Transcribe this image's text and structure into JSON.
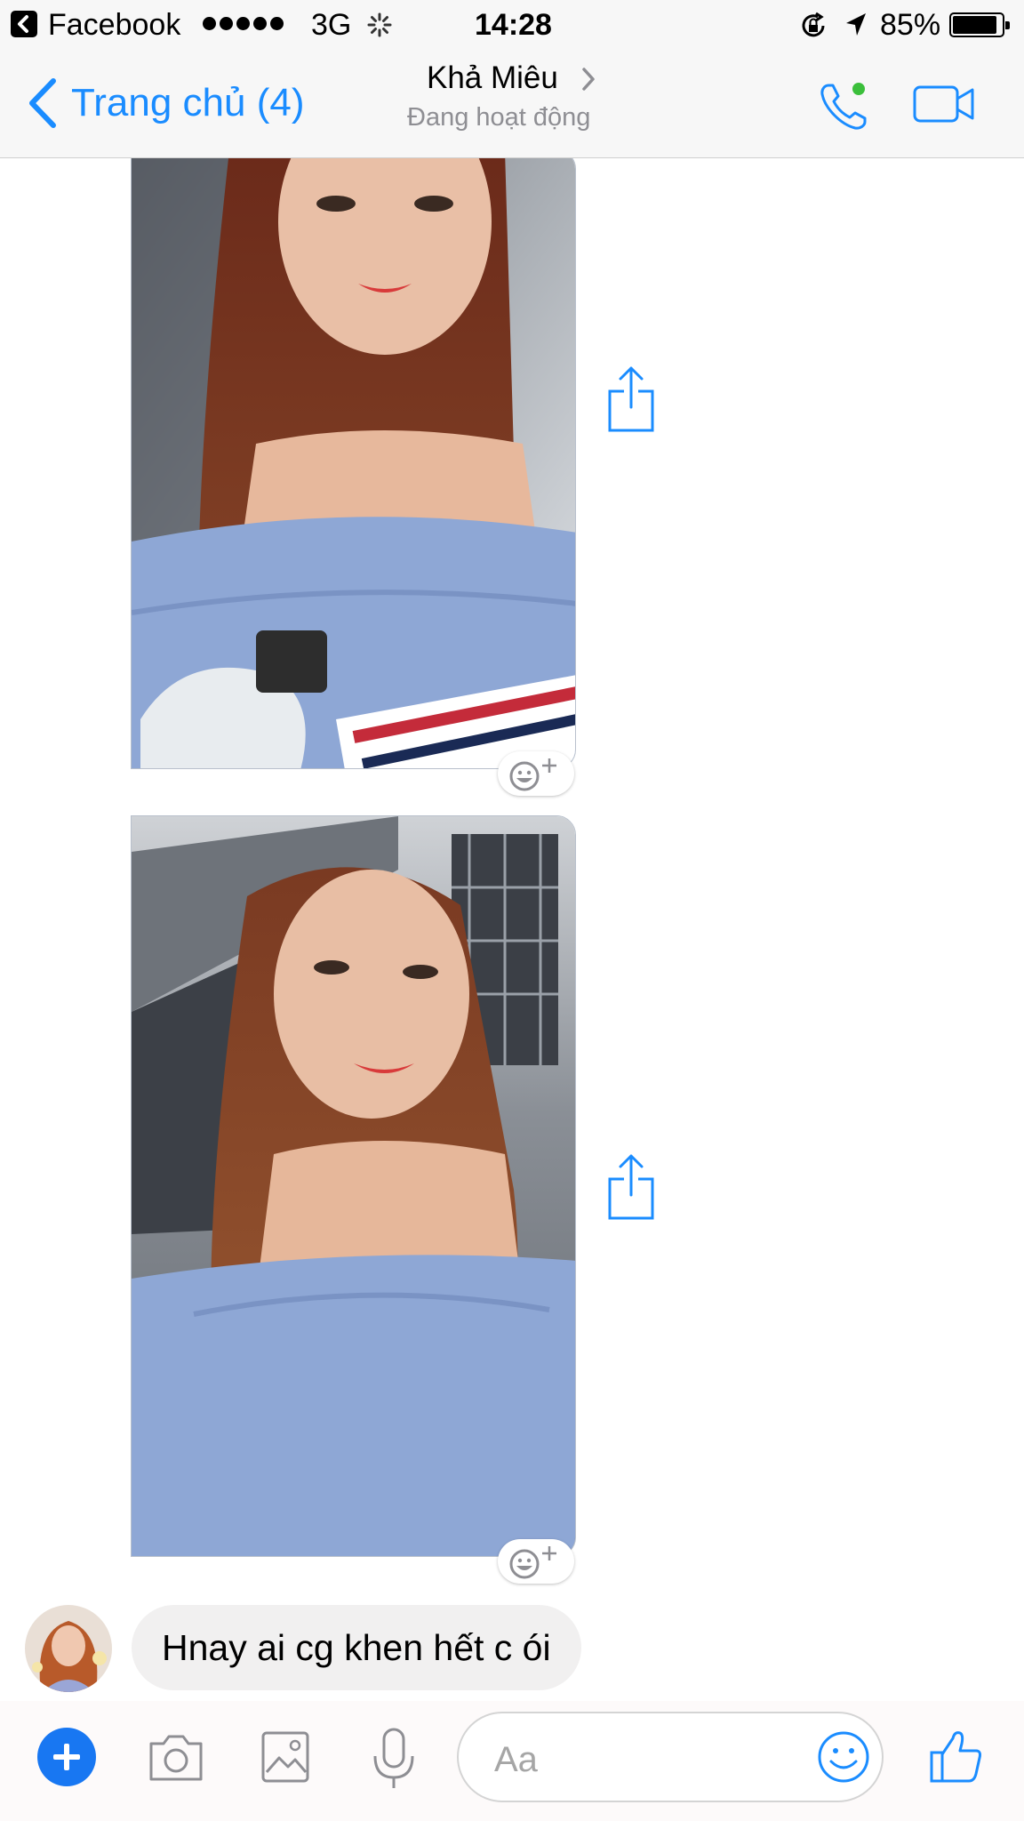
{
  "status_bar": {
    "back_app": "Facebook",
    "network": "3G",
    "time": "14:28",
    "battery": "85%",
    "icons": [
      "back-app-icon",
      "signal-dots-icon",
      "activity-spinner-icon",
      "rotation-lock-icon",
      "location-arrow-icon",
      "battery-icon"
    ]
  },
  "header": {
    "back_label": "Trang chủ (4)",
    "contact_name": "Khả Miêu",
    "contact_status": "Đang hoạt động",
    "icons": [
      "back-chevron-icon",
      "chevron-right-icon",
      "phone-call-icon",
      "video-call-icon"
    ],
    "accent_color": "#1a8cff",
    "online_color": "#3bbf3b"
  },
  "messages": [
    {
      "type": "photo",
      "icons": [
        "share-icon",
        "add-reaction-icon"
      ]
    },
    {
      "type": "photo",
      "icons": [
        "share-icon",
        "add-reaction-icon"
      ]
    },
    {
      "type": "text",
      "text": "Hnay ai cg khen hết c ói",
      "bubble_color": "#f1f0f0"
    }
  ],
  "composer": {
    "placeholder": "Aa",
    "icons": [
      "plus-icon",
      "camera-icon",
      "image-icon",
      "microphone-icon",
      "emoji-icon",
      "thumbs-up-icon"
    ],
    "plus_color": "#1877f2"
  }
}
